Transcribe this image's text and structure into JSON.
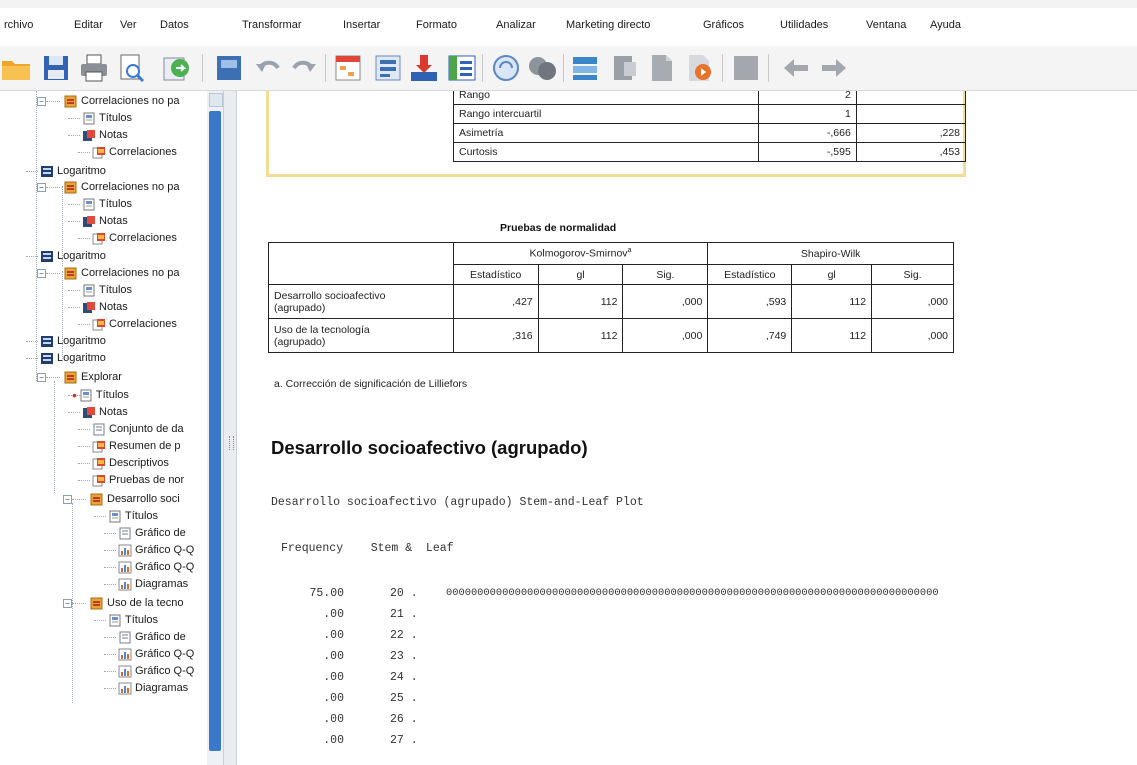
{
  "menu": [
    "rchivo",
    "Editar",
    "Ver",
    "Datos",
    "Transformar",
    "Insertar",
    "Formato",
    "Analizar",
    "Marketing directo",
    "Gráficos",
    "Utilidades",
    "Ventana",
    "Ayuda"
  ],
  "tree": [
    {
      "label": "Correlaciones no pa",
      "icon": "output-book-icon"
    },
    {
      "label": "Títulos",
      "icon": "title-icon"
    },
    {
      "label": "Notas",
      "icon": "notes-icon"
    },
    {
      "label": "Correlaciones",
      "icon": "table-icon"
    },
    {
      "label": "Logaritmo",
      "icon": "log-icon"
    },
    {
      "label": "Correlaciones no pa",
      "icon": "output-book-icon"
    },
    {
      "label": "Títulos",
      "icon": "title-icon"
    },
    {
      "label": "Notas",
      "icon": "notes-icon"
    },
    {
      "label": "Correlaciones",
      "icon": "table-icon"
    },
    {
      "label": "Logaritmo",
      "icon": "log-icon"
    },
    {
      "label": "Correlaciones no pa",
      "icon": "output-book-icon"
    },
    {
      "label": "Títulos",
      "icon": "title-icon"
    },
    {
      "label": "Notas",
      "icon": "notes-icon"
    },
    {
      "label": "Correlaciones",
      "icon": "table-icon"
    },
    {
      "label": "Logaritmo",
      "icon": "log-icon"
    },
    {
      "label": "Logaritmo",
      "icon": "log-icon"
    },
    {
      "label": "Explorar",
      "icon": "output-book-icon"
    },
    {
      "label": "Títulos",
      "icon": "title-icon"
    },
    {
      "label": "Notas",
      "icon": "notes-icon"
    },
    {
      "label": "Conjunto de da",
      "icon": "page-icon"
    },
    {
      "label": "Resumen de p",
      "icon": "table-icon"
    },
    {
      "label": "Descriptivos",
      "icon": "table-icon"
    },
    {
      "label": "Pruebas de nor",
      "icon": "table-icon"
    },
    {
      "label": "Desarrollo soci",
      "icon": "output-book-icon"
    },
    {
      "label": "Títulos",
      "icon": "title-icon"
    },
    {
      "label": "Gráfico de",
      "icon": "page-icon"
    },
    {
      "label": "Gráfico Q-Q",
      "icon": "chart-icon"
    },
    {
      "label": "Gráfico Q-Q",
      "icon": "chart-icon"
    },
    {
      "label": "Diagramas",
      "icon": "chart-icon"
    },
    {
      "label": "Uso de la tecno",
      "icon": "output-book-icon"
    },
    {
      "label": "Títulos",
      "icon": "title-icon"
    },
    {
      "label": "Gráfico de",
      "icon": "page-icon"
    },
    {
      "label": "Gráfico Q-Q",
      "icon": "chart-icon"
    },
    {
      "label": "Gráfico Q-Q",
      "icon": "chart-icon"
    },
    {
      "label": "Diagramas",
      "icon": "chart-icon"
    }
  ],
  "descriptives_rows": [
    {
      "label": "Rango",
      "stat": "2",
      "err": ""
    },
    {
      "label": "Rango intercuartil",
      "stat": "1",
      "err": ""
    },
    {
      "label": "Asimetría",
      "stat": "-,666",
      "err": ",228"
    },
    {
      "label": "Curtosis",
      "stat": "-,595",
      "err": ",453"
    }
  ],
  "normality": {
    "title": "Pruebas de normalidad",
    "group1": "Kolmogorov-Smirnov",
    "group1_sup": "a",
    "group2": "Shapiro-Wilk",
    "subheaders": [
      "Estadístico",
      "gl",
      "Sig.",
      "Estadístico",
      "gl",
      "Sig."
    ],
    "rows": [
      {
        "label1": "Desarrollo socioafectivo",
        "label2": "(agrupado)",
        "values": [
          ",427",
          "112",
          ",000",
          ",593",
          "112",
          ",000"
        ]
      },
      {
        "label1": "Uso de la tecnología",
        "label2": "(agrupado)",
        "values": [
          ",316",
          "112",
          ",000",
          ",749",
          "112",
          ",000"
        ]
      }
    ],
    "footnote": "a. Corrección de significación de Lilliefors"
  },
  "section_title": "Desarrollo socioafectivo (agrupado)",
  "stemleaf": {
    "caption": "Desarrollo socioafectivo (agrupado) Stem-and-Leaf Plot",
    "header": "Frequency    Stem &  Leaf",
    "rows": [
      {
        "freq": "75.00",
        "stem": "20 .",
        "leaf": "0000000000000000000000000000000000000000000000000000000000000000000000000000000"
      },
      {
        "freq": ".00",
        "stem": "21 .",
        "leaf": ""
      },
      {
        "freq": ".00",
        "stem": "22 .",
        "leaf": ""
      },
      {
        "freq": ".00",
        "stem": "23 .",
        "leaf": ""
      },
      {
        "freq": ".00",
        "stem": "24 .",
        "leaf": ""
      },
      {
        "freq": ".00",
        "stem": "25 .",
        "leaf": ""
      },
      {
        "freq": ".00",
        "stem": "26 .",
        "leaf": ""
      },
      {
        "freq": ".00",
        "stem": "27 .",
        "leaf": ""
      }
    ]
  }
}
